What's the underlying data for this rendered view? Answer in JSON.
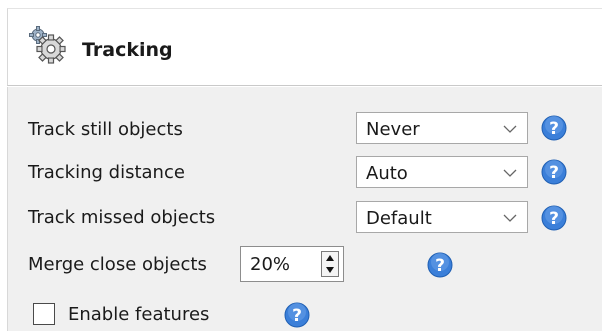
{
  "panel": {
    "title": "Tracking",
    "icon": "gears-icon"
  },
  "rows": [
    {
      "label": "Track still objects",
      "value": "Never"
    },
    {
      "label": "Tracking distance",
      "value": "Auto"
    },
    {
      "label": "Track missed objects",
      "value": "Default"
    }
  ],
  "merge": {
    "label": "Merge close objects",
    "value": "20%"
  },
  "features": {
    "label": "Enable features",
    "checked": false
  },
  "colors": {
    "help_fill": "#3b7fd9",
    "body_bg": "#f0f0f0"
  }
}
